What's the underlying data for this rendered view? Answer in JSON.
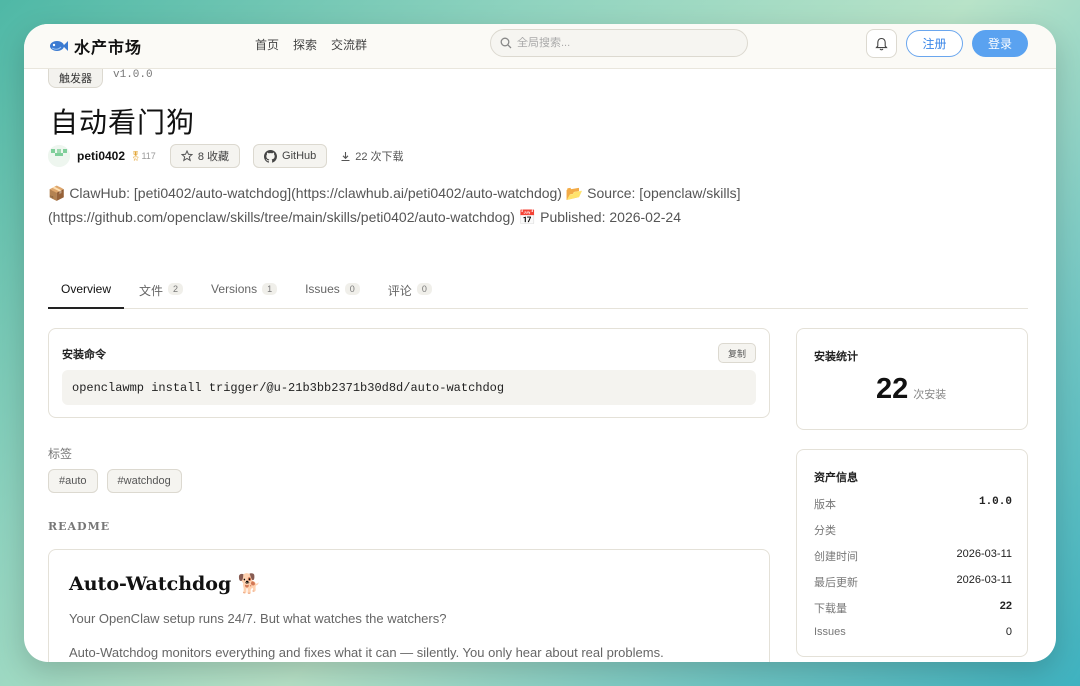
{
  "header": {
    "logo_text": "水产市场",
    "nav": [
      "首页",
      "探索",
      "交流群"
    ],
    "search_placeholder": "全局搜索...",
    "register_label": "注册",
    "login_label": "登录"
  },
  "asset": {
    "category": "触发器",
    "version": "v1.0.0",
    "title": "自动看门狗",
    "author": "peti0402",
    "author_rep": "117",
    "favorites_label": "8 收藏",
    "github_label": "GitHub",
    "downloads_label": "22 次下载",
    "description_line1": "📦 ClawHub: [peti0402/auto-watchdog](https://clawhub.ai/peti0402/auto-watchdog) 📂 Source: [openclaw/skills]",
    "description_line2": "(https://github.com/openclaw/skills/tree/main/skills/peti0402/auto-watchdog) 📅 Published: 2026-02-24"
  },
  "tabs": [
    {
      "label": "Overview",
      "count": null
    },
    {
      "label": "文件",
      "count": "2"
    },
    {
      "label": "Versions",
      "count": "1"
    },
    {
      "label": "Issues",
      "count": "0"
    },
    {
      "label": "评论",
      "count": "0"
    }
  ],
  "install": {
    "label": "安装命令",
    "copy_label": "复制",
    "command": "openclawmp install trigger/@u-21b3bb2371b30d8d/auto-watchdog"
  },
  "tags_section": {
    "label": "标签",
    "tags": [
      "#auto",
      "#watchdog"
    ]
  },
  "readme": {
    "label": "README",
    "title": "Auto-Watchdog 🐕",
    "p1": "Your OpenClaw setup runs 24/7. But what watches the watchers?",
    "p2": "Auto-Watchdog monitors everything and fixes what it can — silently. You only hear about real problems."
  },
  "stats": {
    "title": "安装统计",
    "count": "22",
    "unit": "次安装"
  },
  "info": {
    "title": "资产信息",
    "rows": [
      {
        "key": "版本",
        "value": "1.0.0"
      },
      {
        "key": "分类",
        "value": ""
      },
      {
        "key": "创建时间",
        "value": "2026-03-11"
      },
      {
        "key": "最后更新",
        "value": "2026-03-11"
      },
      {
        "key": "下载量",
        "value": "22"
      },
      {
        "key": "Issues",
        "value": "0"
      }
    ]
  },
  "colors": {
    "primary": "#5aa2f0",
    "medal": "#e3a536"
  }
}
